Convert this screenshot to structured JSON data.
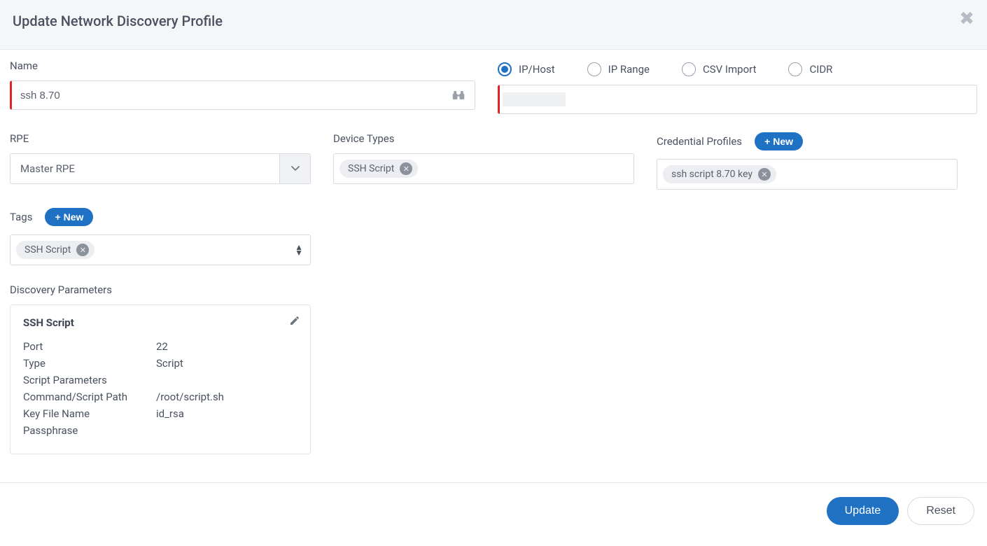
{
  "header": {
    "title": "Update Network Discovery Profile"
  },
  "name": {
    "label": "Name",
    "value": "ssh 8.70"
  },
  "source": {
    "options": [
      "IP/Host",
      "IP Range",
      "CSV Import",
      "CIDR"
    ],
    "selected": "IP/Host",
    "value": ""
  },
  "rpe": {
    "label": "RPE",
    "value": "Master RPE"
  },
  "device_types": {
    "label": "Device Types",
    "chips": [
      "SSH Script"
    ]
  },
  "credential_profiles": {
    "label": "Credential Profiles",
    "new_label": "New",
    "chips": [
      "ssh script 8.70 key"
    ]
  },
  "tags": {
    "label": "Tags",
    "new_label": "New",
    "chips": [
      "SSH Script"
    ]
  },
  "discovery_parameters": {
    "label": "Discovery Parameters",
    "card_title": "SSH Script",
    "rows": [
      {
        "k": "Port",
        "v": "22"
      },
      {
        "k": "Type",
        "v": "Script"
      },
      {
        "k": "Script Parameters",
        "v": ""
      },
      {
        "k": "Command/Script Path",
        "v": "/root/script.sh"
      },
      {
        "k": "Key File Name",
        "v": "id_rsa"
      },
      {
        "k": "Passphrase",
        "v": ""
      }
    ]
  },
  "footer": {
    "update": "Update",
    "reset": "Reset"
  }
}
